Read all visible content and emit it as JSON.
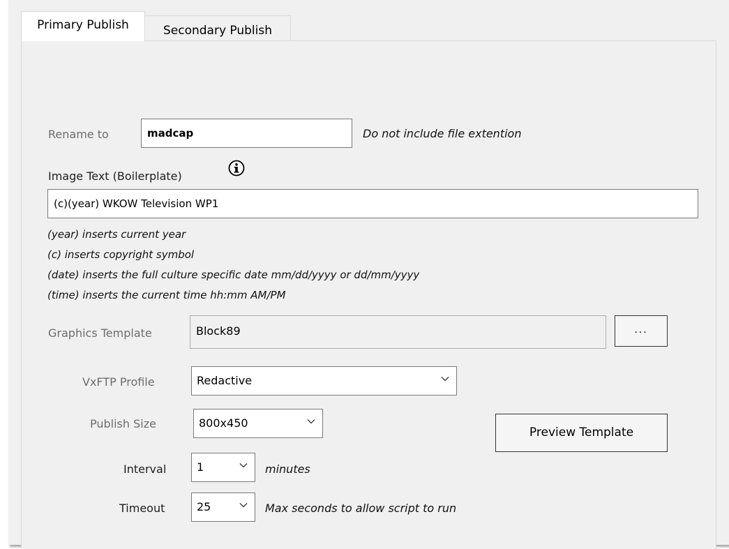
{
  "tabs": [
    {
      "label": "Primary Publish",
      "active": true
    },
    {
      "label": "Secondary Publish",
      "active": false
    }
  ],
  "rename": {
    "label": "Rename to",
    "value": "madcap",
    "hint": "Do not include file extention"
  },
  "image_text": {
    "label": "Image Text (Boilerplate)",
    "info_icon": "info-icon",
    "value": "(c)(year) WKOW Television WP1",
    "help": [
      "(year) inserts current year",
      "(c) inserts copyright symbol",
      "(date) inserts the full culture specific date mm/dd/yyyy or dd/mm/yyyy",
      "(time) inserts the current time hh:mm AM/PM"
    ]
  },
  "graphics_template": {
    "label": "Graphics Template",
    "value": "Block89",
    "browse_label": "..."
  },
  "vxftp_profile": {
    "label": "VxFTP Profile",
    "value": "Redactive"
  },
  "publish_size": {
    "label": "Publish Size",
    "value": "800x450"
  },
  "preview_button": {
    "label": "Preview Template"
  },
  "interval": {
    "label": "Interval",
    "value": "1",
    "unit": "minutes"
  },
  "timeout": {
    "label": "Timeout",
    "value": "25",
    "hint": "Max seconds to allow script to run"
  },
  "colors": {
    "annotation_arrow": "#1a1aff",
    "dialog_bg": "#f0f0f0"
  }
}
